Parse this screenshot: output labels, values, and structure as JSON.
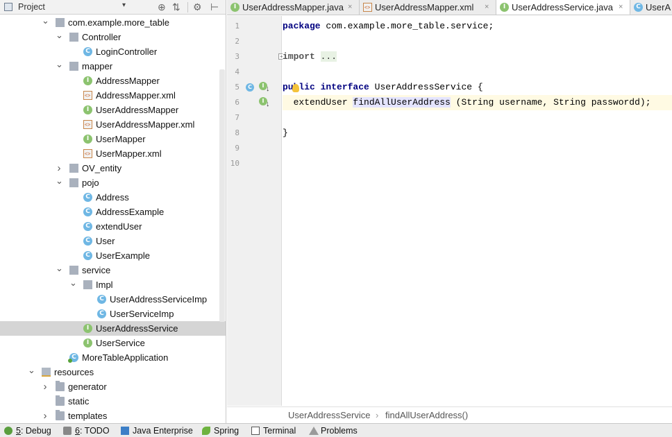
{
  "project_panel": {
    "title": "Project",
    "dropdown_glyph": "▾",
    "buttons": [
      "⊕",
      "⇅",
      "⚙",
      "⊢"
    ]
  },
  "tree": [
    {
      "label": "com.example.more_table",
      "icon": "package",
      "expanded": true
    },
    {
      "label": "Controller",
      "icon": "package",
      "expanded": true
    },
    {
      "label": "LoginController",
      "icon": "class",
      "letter": "C"
    },
    {
      "label": "mapper",
      "icon": "package",
      "expanded": true
    },
    {
      "label": "AddressMapper",
      "icon": "interface",
      "letter": "I"
    },
    {
      "label": "AddressMapper.xml",
      "icon": "xml"
    },
    {
      "label": "UserAddressMapper",
      "icon": "interface",
      "letter": "I"
    },
    {
      "label": "UserAddressMapper.xml",
      "icon": "xml"
    },
    {
      "label": "UserMapper",
      "icon": "interface",
      "letter": "I"
    },
    {
      "label": "UserMapper.xml",
      "icon": "xml"
    },
    {
      "label": "OV_entity",
      "icon": "package",
      "expanded": false
    },
    {
      "label": "pojo",
      "icon": "package",
      "expanded": true
    },
    {
      "label": "Address",
      "icon": "class",
      "letter": "C"
    },
    {
      "label": "AddressExample",
      "icon": "class",
      "letter": "C"
    },
    {
      "label": "extendUser",
      "icon": "class",
      "letter": "C"
    },
    {
      "label": "User",
      "icon": "class",
      "letter": "C"
    },
    {
      "label": "UserExample",
      "icon": "class",
      "letter": "C"
    },
    {
      "label": "service",
      "icon": "package",
      "expanded": true
    },
    {
      "label": "Impl",
      "icon": "package",
      "expanded": true
    },
    {
      "label": "UserAddressServiceImp",
      "icon": "class",
      "letter": "C"
    },
    {
      "label": "UserServiceImp",
      "icon": "class",
      "letter": "C"
    },
    {
      "label": "UserAddressService",
      "icon": "interface",
      "letter": "I",
      "selected": true
    },
    {
      "label": "UserService",
      "icon": "interface",
      "letter": "I"
    },
    {
      "label": "MoreTableApplication",
      "icon": "app",
      "letter": "C"
    },
    {
      "label": "resources",
      "icon": "resources",
      "expanded": true
    },
    {
      "label": "generator",
      "icon": "folder",
      "expanded": false
    },
    {
      "label": "static",
      "icon": "folder"
    },
    {
      "label": "templates",
      "icon": "folder",
      "expanded": false
    }
  ],
  "tabs": [
    {
      "label": "UserAddressMapper.java",
      "icon": "interface",
      "letter": "I",
      "close": "×"
    },
    {
      "label": "UserAddressMapper.xml",
      "icon": "xml",
      "close": "×"
    },
    {
      "label": "UserAddressService.java",
      "icon": "interface",
      "letter": "I",
      "active": true,
      "close": "×"
    },
    {
      "label": "UserA",
      "icon": "class",
      "letter": "C"
    }
  ],
  "editor": {
    "line_numbers": [
      "1",
      "2",
      "3",
      "4",
      "5",
      "6",
      "7",
      "8",
      "9",
      "10"
    ],
    "line1": {
      "kw": "package",
      "rest": " com.example.more_table.service;"
    },
    "line3": {
      "kw": "import",
      "folded": "..."
    },
    "line6": {
      "kw1": "public",
      "kw2": "interface",
      "name": " UserAddressService {"
    },
    "line7": {
      "type": "  extendUser ",
      "method": "findAllUserAddress",
      "params": " (String username, String passwordd);"
    },
    "line9": "}"
  },
  "breadcrumb": {
    "items": [
      "UserAddressService",
      "findAllUserAddress()"
    ],
    "separator": "›"
  },
  "toolbar": [
    {
      "mnemonic": "5",
      "label": ": Debug",
      "icon": "debug-icon"
    },
    {
      "mnemonic": "6",
      "label": ": TODO",
      "icon": "todo-icon"
    },
    {
      "label": "Java Enterprise",
      "icon": "java-enterprise-icon"
    },
    {
      "label": "Spring",
      "icon": "spring-icon"
    },
    {
      "label": "Terminal",
      "icon": "terminal-icon"
    },
    {
      "label": "Problems",
      "icon": "problems-icon"
    }
  ]
}
